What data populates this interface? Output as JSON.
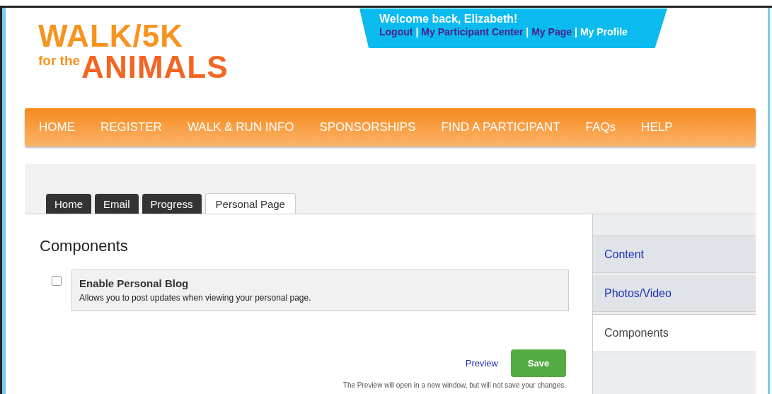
{
  "logo": {
    "line_1": "WALK/5K",
    "line_2_small": "for the",
    "line_2": "ANIMALS"
  },
  "welcome": {
    "greeting": "Welcome back, Elizabeth!",
    "links": [
      {
        "label": "Logout",
        "selected": false
      },
      {
        "label": "My Participant Center",
        "selected": false
      },
      {
        "label": "My Page",
        "selected": false
      },
      {
        "label": "My Profile",
        "selected": true
      }
    ],
    "separator": "|"
  },
  "nav": [
    "HOME",
    "REGISTER",
    "WALK & RUN INFO",
    "SPONSORSHIPS",
    "FIND A PARTICIPANT",
    "FAQs",
    "HELP"
  ],
  "tabs": [
    {
      "label": "Home",
      "selected": false
    },
    {
      "label": "Email",
      "selected": false
    },
    {
      "label": "Progress",
      "selected": false
    },
    {
      "label": "Personal Page",
      "selected": true
    }
  ],
  "heading": "Components",
  "components": [
    {
      "title": "Enable Personal Blog",
      "description": "Allows you to post updates when viewing your personal page.",
      "checked": false
    }
  ],
  "preview_link": "Preview",
  "save_button": "Save",
  "note": "The Preview will open in a new window, but will not save your changes.",
  "sidebar": [
    {
      "label": "Content",
      "selected": false
    },
    {
      "label": "Photos/Video",
      "selected": false
    },
    {
      "label": "Components",
      "selected": true
    }
  ]
}
